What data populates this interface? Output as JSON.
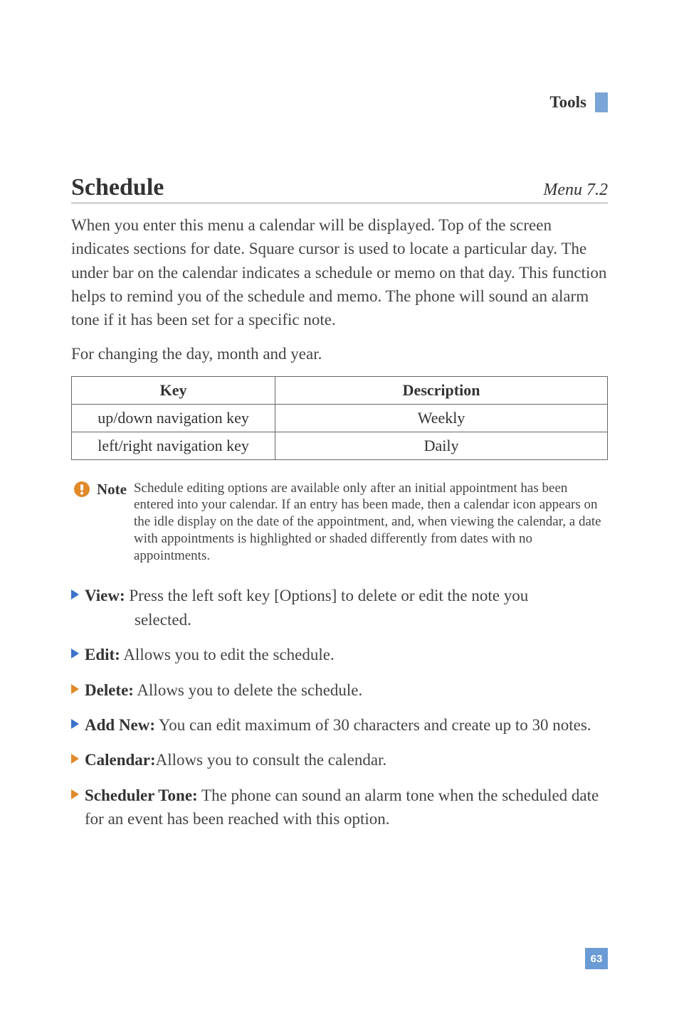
{
  "header": {
    "title": "Tools"
  },
  "section": {
    "title": "Schedule",
    "menu_ref": "Menu 7.2",
    "intro": "When you enter this menu a calendar will be displayed. Top of the screen indicates sections for date. Square cursor is used to locate a particular day. The under bar on the calendar indicates a schedule or memo on that day. This function helps to remind you of the schedule and memo. The phone will sound an alarm tone if it has been set for a specific note.",
    "sub": "For changing the day, month and year."
  },
  "table": {
    "head_key": "Key",
    "head_desc": "Description",
    "rows": [
      {
        "key": "up/down navigation key",
        "desc": "Weekly"
      },
      {
        "key": "left/right navigation key",
        "desc": "Daily"
      }
    ]
  },
  "note": {
    "label": "Note",
    "text": "Schedule editing options are available only after an initial appointment has been entered into your calendar. If an entry has been made, then a calendar icon appears on the idle display on the date of the appointment, and, when viewing the calendar, a date with appointments is highlighted or shaded differently from dates with no appointments."
  },
  "bullets": [
    {
      "color": "blue",
      "label": "View:",
      "text_line1": " Press the left soft key [Options] to delete or edit the note you",
      "text_line2": "selected."
    },
    {
      "color": "blue",
      "label": "Edit:",
      "text": " Allows you to edit the schedule."
    },
    {
      "color": "orange",
      "label": "Delete:",
      "text": " Allows you to delete the schedule."
    },
    {
      "color": "blue",
      "label": "Add New:",
      "text": " You can edit maximum of 30 characters and create up to 30 notes."
    },
    {
      "color": "orange",
      "label": "Calendar:",
      "text": "Allows you to consult the calendar."
    },
    {
      "color": "orange",
      "label": "Scheduler Tone:",
      "text": " The phone can sound an alarm tone when the scheduled date for an event has been reached with this option."
    }
  ],
  "page_number": "63"
}
